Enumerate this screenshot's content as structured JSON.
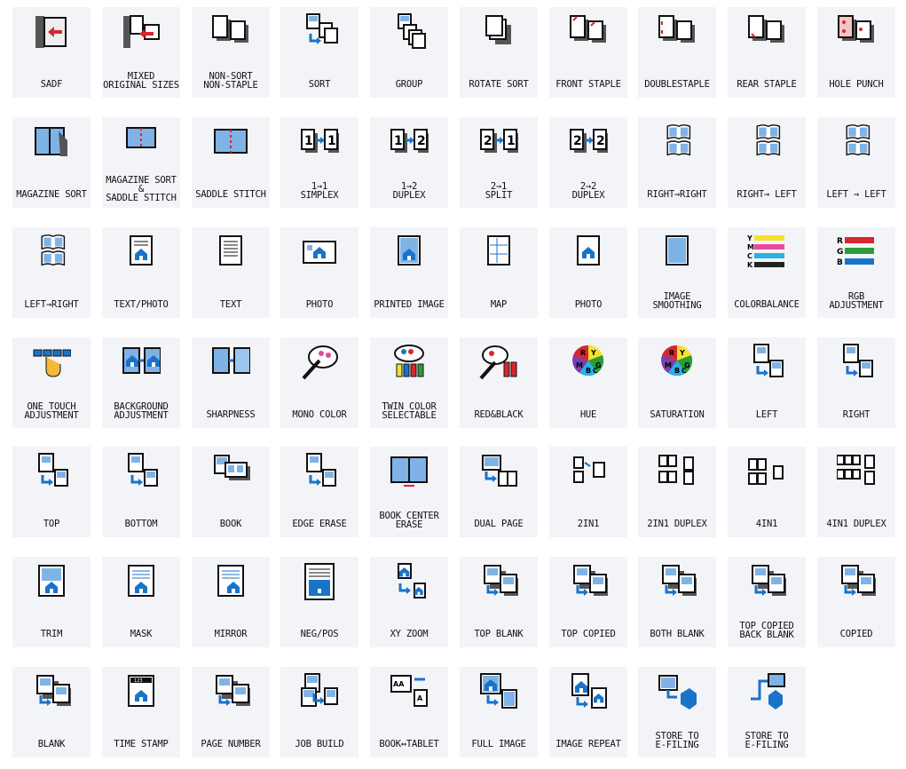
{
  "colors": {
    "tile_bg": "#f3f4f8",
    "page_bg": "#ffffff",
    "accent_blue": "#1a73c9",
    "red": "#d8262e",
    "dark": "#111111"
  },
  "rows": [
    [
      {
        "name": "sadf",
        "icon": "sadf-icon",
        "label": "SADF"
      },
      {
        "name": "mixed-original-sizes",
        "icon": "mixed-sizes-icon",
        "label": "MIXED\nORIGINAL SIZES"
      },
      {
        "name": "non-sort-non-staple",
        "icon": "non-sort-icon",
        "label": "NON-SORT\nNON-STAPLE"
      },
      {
        "name": "sort",
        "icon": "sort-icon",
        "label": "SORT"
      },
      {
        "name": "group",
        "icon": "group-icon",
        "label": "GROUP"
      },
      {
        "name": "rotate-sort",
        "icon": "rotate-sort-icon",
        "label": "ROTATE SORT"
      },
      {
        "name": "front-staple",
        "icon": "front-staple-icon",
        "label": "FRONT STAPLE"
      },
      {
        "name": "double-staple",
        "icon": "double-staple-icon",
        "label": "DOUBLESTAPLE"
      },
      {
        "name": "rear-staple",
        "icon": "rear-staple-icon",
        "label": "REAR STAPLE"
      },
      {
        "name": "hole-punch",
        "icon": "hole-punch-icon",
        "label": "HOLE PUNCH"
      }
    ],
    [
      {
        "name": "magazine-sort",
        "icon": "magazine-sort-icon",
        "label": "MAGAZINE SORT"
      },
      {
        "name": "magazine-sort-saddle-stitch",
        "icon": "magazine-saddle-icon",
        "label": "MAGAZINE SORT\n&\nSADDLE STITCH"
      },
      {
        "name": "saddle-stitch",
        "icon": "saddle-stitch-icon",
        "label": "SADDLE STITCH"
      },
      {
        "name": "simplex-1-1",
        "icon": "one-to-one-icon",
        "label": "1→1\nSIMPLEX"
      },
      {
        "name": "duplex-1-2",
        "icon": "one-to-two-icon",
        "label": "1→2\nDUPLEX"
      },
      {
        "name": "split-2-1",
        "icon": "two-to-one-icon",
        "label": "2→1\nSPLIT"
      },
      {
        "name": "duplex-2-2",
        "icon": "two-to-two-icon",
        "label": "2→2\nDUPLEX"
      },
      {
        "name": "right-to-right",
        "icon": "book-right-right-icon",
        "label": "RIGHT→RIGHT"
      },
      {
        "name": "right-to-left",
        "icon": "book-right-left-icon",
        "label": "RIGHT→ LEFT"
      },
      {
        "name": "left-to-left",
        "icon": "book-left-left-icon",
        "label": "LEFT → LEFT"
      }
    ],
    [
      {
        "name": "left-to-right",
        "icon": "book-left-right-icon",
        "label": "LEFT→RIGHT"
      },
      {
        "name": "text-photo",
        "icon": "text-photo-icon",
        "label": "TEXT/PHOTO"
      },
      {
        "name": "text",
        "icon": "text-icon",
        "label": "TEXT"
      },
      {
        "name": "photo",
        "icon": "photo-icon",
        "label": "PHOTO"
      },
      {
        "name": "printed-image",
        "icon": "printed-image-icon",
        "label": "PRINTED IMAGE"
      },
      {
        "name": "map",
        "icon": "map-icon",
        "label": "MAP"
      },
      {
        "name": "photo-2",
        "icon": "photo-page-icon",
        "label": "PHOTO"
      },
      {
        "name": "image-smoothing",
        "icon": "image-smoothing-icon",
        "label": "IMAGE\nSMOOTHING"
      },
      {
        "name": "color-balance",
        "icon": "color-balance-icon",
        "label": "COLORBALANCE"
      },
      {
        "name": "rgb-adjustment",
        "icon": "rgb-adjustment-icon",
        "label": "RGB\nADJUSTMENT"
      }
    ],
    [
      {
        "name": "one-touch-adjustment",
        "icon": "one-touch-icon",
        "label": "ONE TOUCH\nADJUSTMENT"
      },
      {
        "name": "background-adjustment",
        "icon": "background-adjustment-icon",
        "label": "BACKGROUND\nADJUSTMENT"
      },
      {
        "name": "sharpness",
        "icon": "sharpness-icon",
        "label": "SHARPNESS"
      },
      {
        "name": "mono-color",
        "icon": "mono-color-icon",
        "label": "MONO COLOR"
      },
      {
        "name": "twin-color-selectable",
        "icon": "twin-color-icon",
        "label": "TWIN COLOR\nSELECTABLE"
      },
      {
        "name": "red-black",
        "icon": "red-black-icon",
        "label": "RED&BLACK"
      },
      {
        "name": "hue",
        "icon": "hue-wheel-icon",
        "label": "HUE"
      },
      {
        "name": "saturation",
        "icon": "saturation-wheel-icon",
        "label": "SATURATION"
      },
      {
        "name": "left",
        "icon": "shift-left-icon",
        "label": "LEFT"
      },
      {
        "name": "right",
        "icon": "shift-right-icon",
        "label": "RIGHT"
      }
    ],
    [
      {
        "name": "top",
        "icon": "shift-top-icon",
        "label": "TOP"
      },
      {
        "name": "bottom",
        "icon": "shift-bottom-icon",
        "label": "BOTTOM"
      },
      {
        "name": "book",
        "icon": "book-icon",
        "label": "BOOK"
      },
      {
        "name": "edge-erase",
        "icon": "edge-erase-icon",
        "label": "EDGE ERASE"
      },
      {
        "name": "book-center-erase",
        "icon": "book-center-erase-icon",
        "label": "BOOK CENTER\nERASE"
      },
      {
        "name": "dual-page",
        "icon": "dual-page-icon",
        "label": "DUAL PAGE"
      },
      {
        "name": "2in1",
        "icon": "two-in-one-icon",
        "label": "2IN1"
      },
      {
        "name": "2in1-duplex",
        "icon": "two-in-one-duplex-icon",
        "label": "2IN1 DUPLEX"
      },
      {
        "name": "4in1",
        "icon": "four-in-one-icon",
        "label": "4IN1"
      },
      {
        "name": "4in1-duplex",
        "icon": "four-in-one-duplex-icon",
        "label": "4IN1 DUPLEX"
      }
    ],
    [
      {
        "name": "trim",
        "icon": "trim-icon",
        "label": "TRIM"
      },
      {
        "name": "mask",
        "icon": "mask-icon",
        "label": "MASK"
      },
      {
        "name": "mirror",
        "icon": "mirror-icon",
        "label": "MIRROR"
      },
      {
        "name": "neg-pos",
        "icon": "neg-pos-icon",
        "label": "NEG/POS"
      },
      {
        "name": "xy-zoom",
        "icon": "xy-zoom-icon",
        "label": "XY ZOOM"
      },
      {
        "name": "top-blank",
        "icon": "top-blank-icon",
        "label": "TOP BLANK"
      },
      {
        "name": "top-copied",
        "icon": "top-copied-icon",
        "label": "TOP COPIED"
      },
      {
        "name": "both-blank",
        "icon": "both-blank-icon",
        "label": "BOTH BLANK"
      },
      {
        "name": "top-copied-back-blank",
        "icon": "top-copied-back-blank-icon",
        "label": "TOP COPIED\nBACK BLANK"
      },
      {
        "name": "copied",
        "icon": "copied-icon",
        "label": "COPIED"
      }
    ],
    [
      {
        "name": "blank",
        "icon": "blank-icon",
        "label": "BLANK"
      },
      {
        "name": "time-stamp",
        "icon": "time-stamp-icon",
        "label": "TIME STAMP"
      },
      {
        "name": "page-number",
        "icon": "page-number-icon",
        "label": "PAGE NUMBER"
      },
      {
        "name": "job-build",
        "icon": "job-build-icon",
        "label": "JOB BUILD"
      },
      {
        "name": "book-tablet",
        "icon": "book-tablet-icon",
        "label": "BOOK↔TABLET"
      },
      {
        "name": "full-image",
        "icon": "full-image-icon",
        "label": "FULL IMAGE"
      },
      {
        "name": "image-repeat",
        "icon": "image-repeat-icon",
        "label": "IMAGE REPEAT"
      },
      {
        "name": "store-to-efiling-1",
        "icon": "store-efiling-icon",
        "label": "STORE TO\nE-FILING"
      },
      {
        "name": "store-to-efiling-2",
        "icon": "store-efiling-alt-icon",
        "label": "STORE TO\nE-FILING"
      }
    ]
  ]
}
